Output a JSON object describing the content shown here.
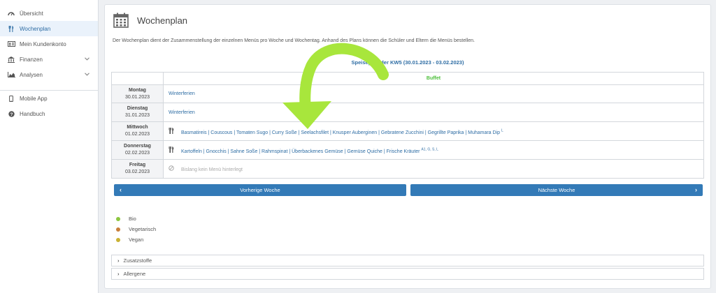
{
  "sidebar": {
    "items": [
      {
        "label": "Übersicht"
      },
      {
        "label": "Wochenplan"
      },
      {
        "label": "Mein Kundenkonto"
      },
      {
        "label": "Finanzen"
      },
      {
        "label": "Analysen"
      }
    ],
    "bottom_items": [
      {
        "label": "Mobile App"
      },
      {
        "label": "Handbuch"
      }
    ]
  },
  "page": {
    "title": "Wochenplan",
    "intro": "Der Wochenplan dient der Zusammenstellung der einzelnen Menüs pro Woche und Wochentag. Anhand des Plans können die Schüler und Eltern die Menüs bestellen.",
    "week_title": "Speiseplan der KW5 (30.01.2023 - 03.02.2023)",
    "column_header": "Buffet"
  },
  "days": [
    {
      "name": "Montag",
      "date": "30.01.2023",
      "menu": "Winterferien"
    },
    {
      "name": "Dienstag",
      "date": "31.01.2023",
      "menu": "Winterferien"
    },
    {
      "name": "Mittwoch",
      "date": "01.02.2023",
      "menu": "Basmatireis | Couscous | Tomaten Sugo | Curry Soße | Seelachsfilet | Knusper Auberginen | Gebratene Zucchini | Gegrillte Paprika | Muhamara Dip",
      "sup": "L"
    },
    {
      "name": "Donnerstag",
      "date": "02.02.2023",
      "menu": "Kartoffeln | Gnocchis | Sahne Soße | Rahmspinat | Überbackenes Gemüse | Gemüse Quiche | Frische Kräuter",
      "sup": "A1, G, S, L"
    },
    {
      "name": "Freitag",
      "date": "03.02.2023",
      "menu": "Bislang kein Menü hinterlegt"
    }
  ],
  "buttons": {
    "prev": "Vorherige Woche",
    "next": "Nächste Woche"
  },
  "legend": [
    {
      "label": "Bio",
      "color": "#8cc63f"
    },
    {
      "label": "Vegetarisch",
      "color": "#c87f3a"
    },
    {
      "label": "Vegan",
      "color": "#c9b233"
    }
  ],
  "collapsibles": [
    {
      "label": "Zusatzstoffe"
    },
    {
      "label": "Allergene"
    }
  ],
  "colors": {
    "accent": "#337ab7",
    "buffet": "#4cbf3a",
    "annotation_arrow": "#a8e63c"
  }
}
